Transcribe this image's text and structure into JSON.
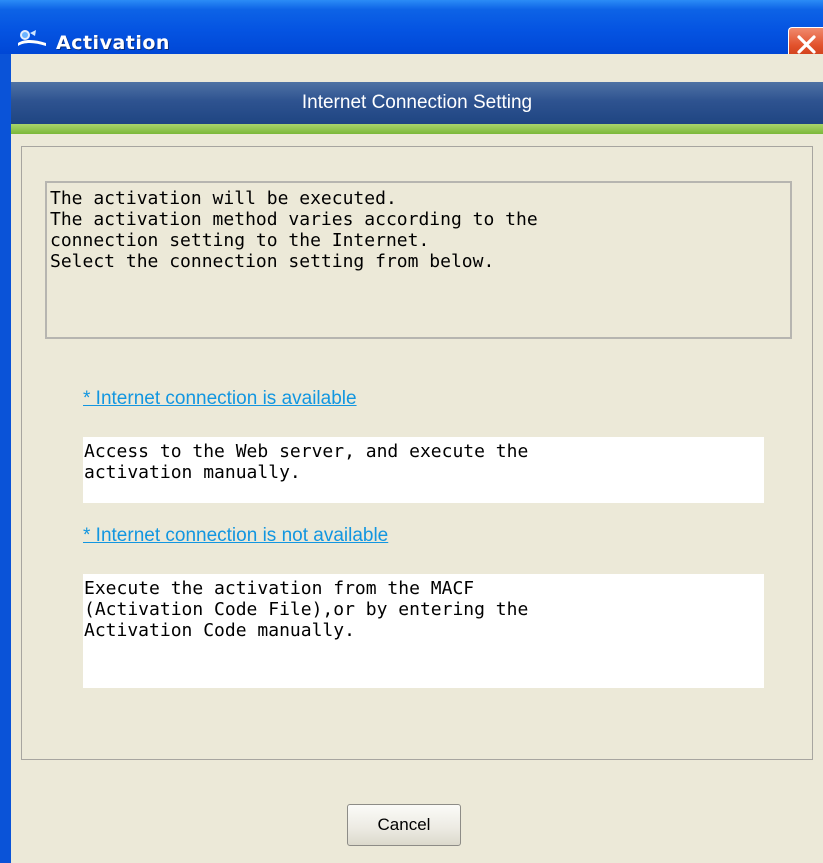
{
  "window": {
    "title": "Activation",
    "icon": "activation-app-icon",
    "close_icon": "close-icon"
  },
  "banner": {
    "title": "Internet Connection Setting"
  },
  "intro": {
    "lines": [
      "The activation will be executed.",
      "The activation method varies according to the",
      "connection setting to the Internet.",
      "Select the connection setting from below."
    ]
  },
  "options": [
    {
      "link": "* Internet connection is available",
      "description": [
        "Access to the Web server, and execute the",
        "activation manually."
      ]
    },
    {
      "link": "* Internet connection is not available",
      "description": [
        "Execute the activation from the MACF",
        "(Activation Code File),or by entering the",
        "Activation Code manually."
      ]
    }
  ],
  "buttons": {
    "cancel": "Cancel"
  },
  "colors": {
    "titlebar": "#0554e2",
    "close": "#e2512b",
    "banner": "#2e5390",
    "accent_green": "#7bb83a",
    "link": "#1296e0",
    "dialog_bg": "#ece9d8"
  }
}
